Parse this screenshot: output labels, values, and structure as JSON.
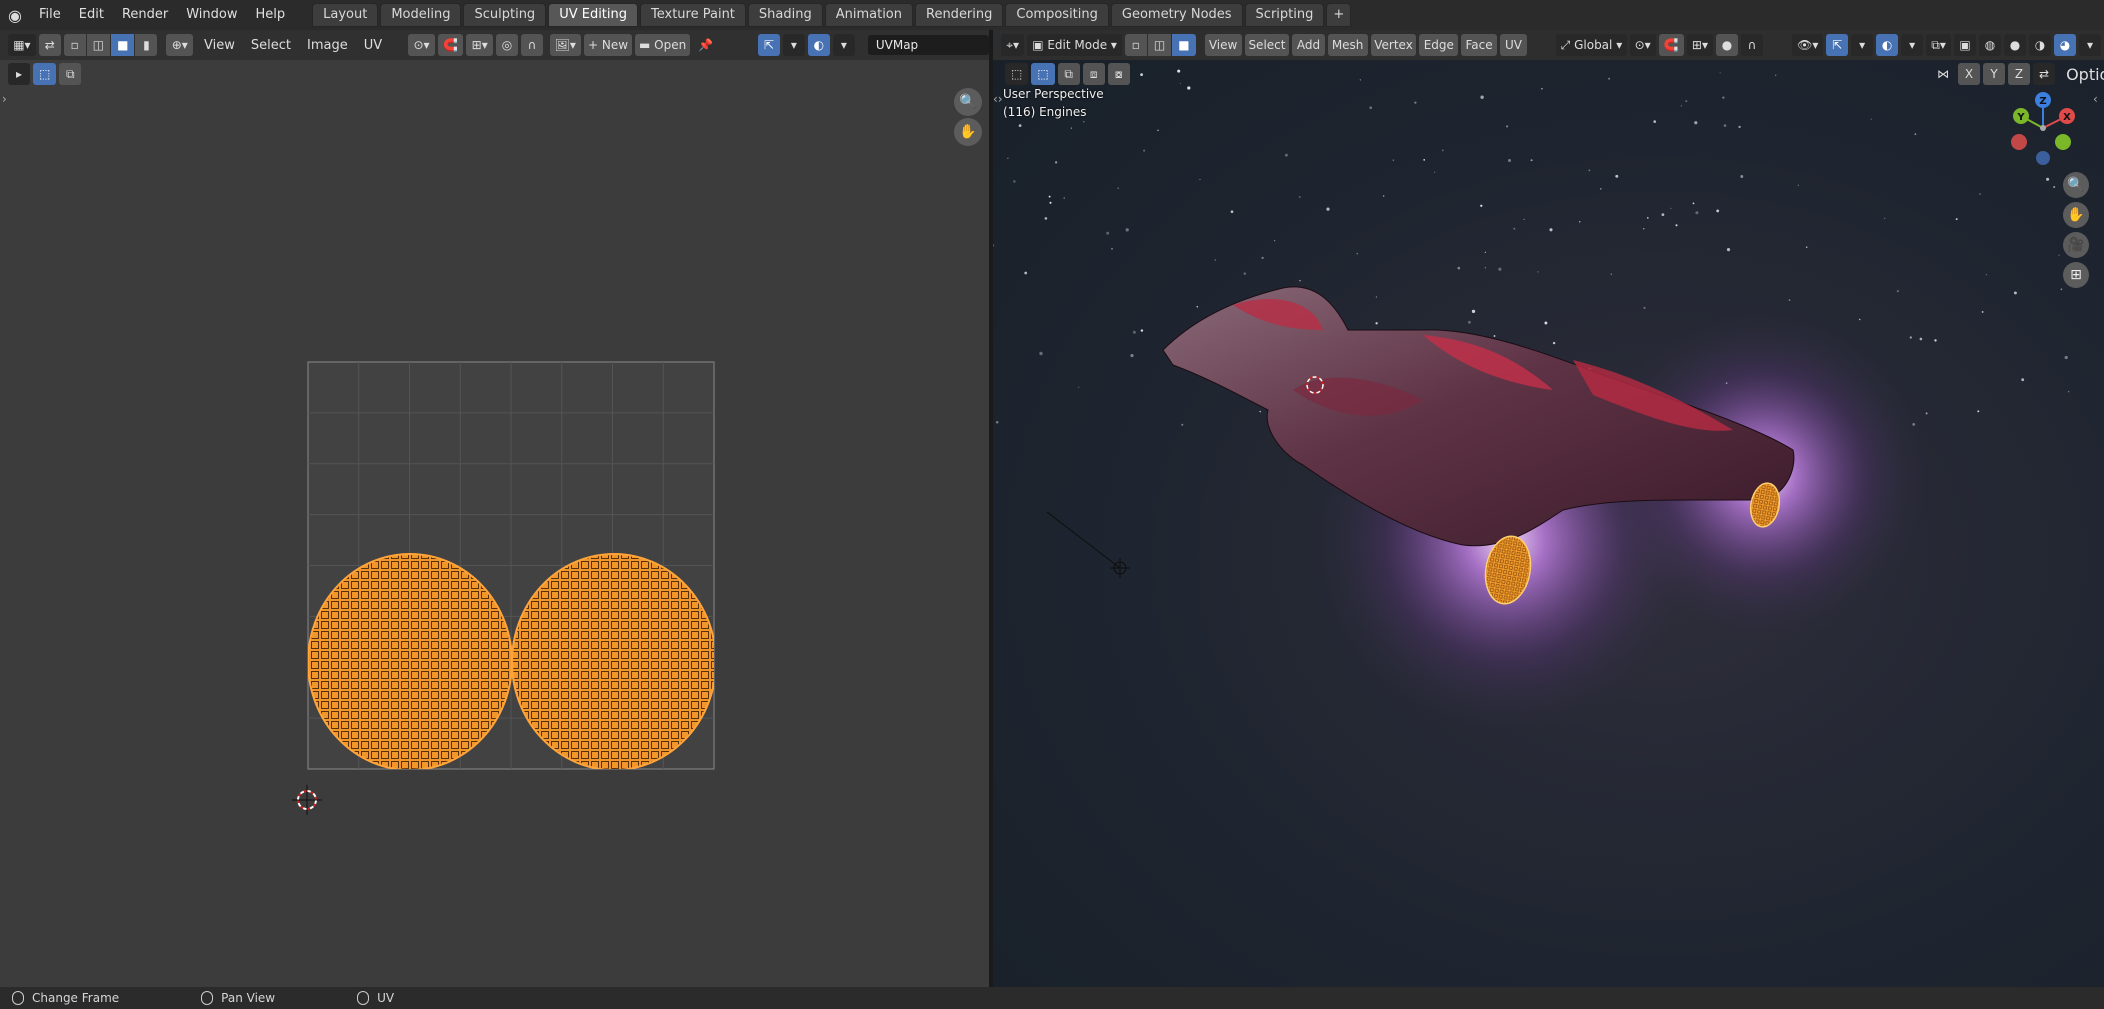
{
  "topbar": {
    "menus": [
      "File",
      "Edit",
      "Render",
      "Window",
      "Help"
    ],
    "tabs": [
      "Layout",
      "Modeling",
      "Sculpting",
      "UV Editing",
      "Texture Paint",
      "Shading",
      "Animation",
      "Rendering",
      "Compositing",
      "Geometry Nodes",
      "Scripting"
    ],
    "active_tab": "UV Editing",
    "add_tab": "+"
  },
  "uv_editor": {
    "menus": [
      "View",
      "Select",
      "Image",
      "UV"
    ],
    "new_label": "New",
    "open_label": "Open",
    "uvmap_name": "UVMap"
  },
  "viewport": {
    "mode": "Edit Mode",
    "menus": [
      "View",
      "Select",
      "Add",
      "Mesh",
      "Vertex",
      "Edge",
      "Face",
      "UV"
    ],
    "orientation": "Global",
    "options_label": "Options",
    "axes": [
      "X",
      "Y",
      "Z"
    ],
    "overlay_line1": "User Perspective",
    "overlay_line2": "(116) Engines",
    "gizmo": {
      "z": "Z",
      "y": "Y",
      "x": "X"
    }
  },
  "statusbar": {
    "items": [
      "Change Frame",
      "Pan View",
      "UV"
    ]
  },
  "colors": {
    "accent": "#4772b3",
    "uv_selected": "#f0962a",
    "uv_background": "#3c3c3c",
    "engine_glow": "#c86cff"
  }
}
